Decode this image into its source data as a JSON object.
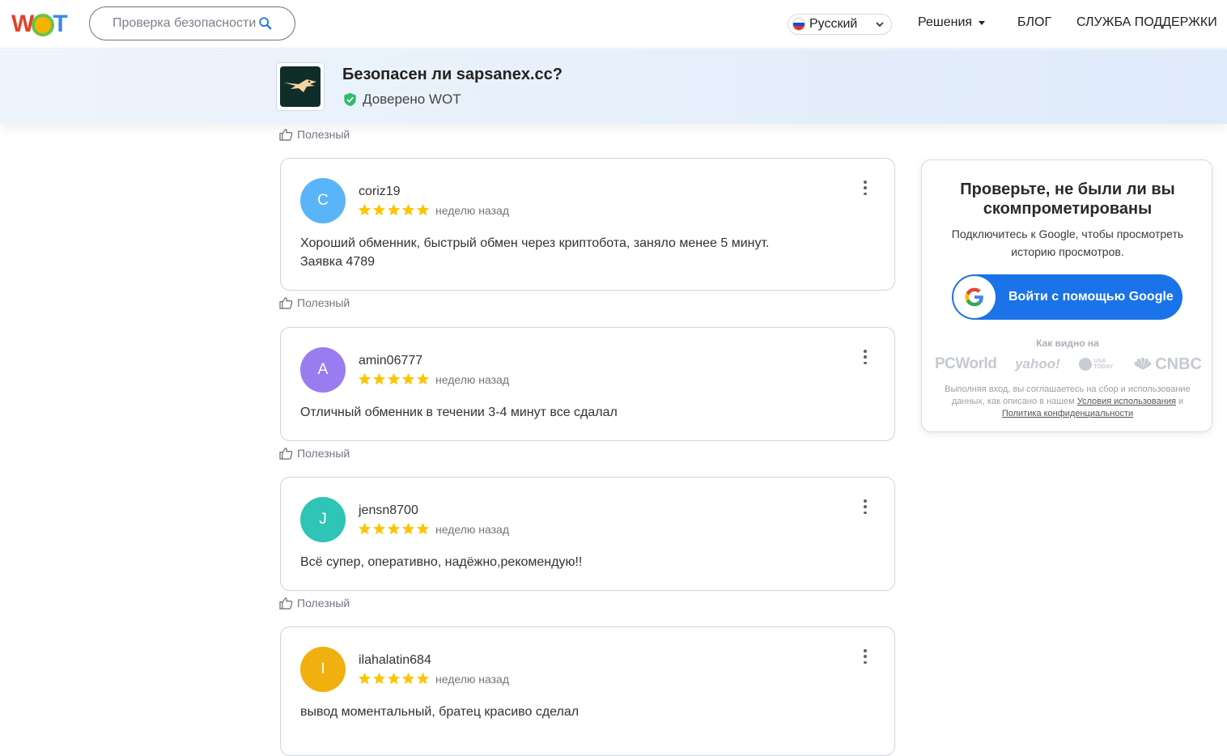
{
  "nav": {
    "logo_letters": [
      "W",
      "T"
    ],
    "search_placeholder": "Проверка безопасности",
    "language": "Русский",
    "solutions": "Решения",
    "blog": "БЛОГ",
    "support": "СЛУЖБА ПОДДЕРЖКИ"
  },
  "site": {
    "title": "Безопасен ли sapsanex.cc?",
    "trust_status": "Доверено WOT"
  },
  "helpful_label": "Полезный",
  "reviews": [
    {
      "initial": "C",
      "user": "coriz19",
      "rating": 5,
      "when": "неделю назад",
      "lines": [
        "Хороший обменник, быстрый обмен через криптобота, заняло менее 5 минут.",
        "Заявка 4789"
      ],
      "avatar_color": "#5ab4f8"
    },
    {
      "initial": "A",
      "user": "amin06777",
      "rating": 5,
      "when": "неделю назад",
      "lines": [
        "Отличный обменник в течении 3-4 минут все сдалал"
      ],
      "avatar_color": "#9a7cf0"
    },
    {
      "initial": "J",
      "user": "jensn8700",
      "rating": 5,
      "when": "неделю назад",
      "lines": [
        "Всё супер, оперативно, надёжно,рекомендую!!"
      ],
      "avatar_color": "#2ec4b6"
    },
    {
      "initial": "I",
      "user": "ilahalatin684",
      "rating": 5,
      "when": "неделю назад",
      "lines": [
        "вывод моментальный, братец красиво сделал"
      ],
      "avatar_color": "#f0b010"
    }
  ],
  "sidebar": {
    "title": "Проверьте, не были ли вы скомпрометированы",
    "description": "Подключитесь к Google, чтобы просмотреть историю просмотров.",
    "google_button": "Войти с помощью Google",
    "as_seen_on": "Как видно на",
    "press": [
      "PCWorld",
      "yahoo!",
      "USA TODAY",
      "CNBC"
    ],
    "legal_prefix": "Выполняя вход, вы соглашаетесь на сбор и использование данных, как описано в нашем",
    "terms_link": "Условия использования",
    "legal_and": "и",
    "privacy_link": "Политика конфиденциальности"
  },
  "colors": {
    "brand_blue": "#1a73e8",
    "star": "#fbc500",
    "trusted_green": "#2ebd6b"
  }
}
